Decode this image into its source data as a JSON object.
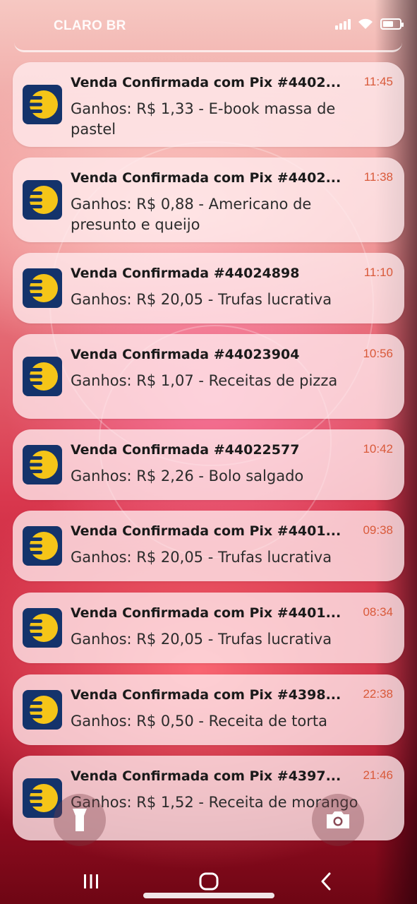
{
  "status_bar": {
    "carrier": "CLARO BR",
    "icons": [
      "signal-icon",
      "wifi-icon",
      "battery-icon"
    ]
  },
  "notifications": [
    {
      "title": "Venda Confirmada com Pix #4402...",
      "time": "11:45",
      "body": "Ganhos: R$ 1,33 - E-book massa de pastel"
    },
    {
      "title": "Venda Confirmada com Pix #4402...",
      "time": "11:38",
      "body": "Ganhos: R$ 0,88 - Americano de presunto e queijo"
    },
    {
      "title": "Venda Confirmada #44024898",
      "time": "11:10",
      "body": "Ganhos: R$ 20,05 - Trufas lucrativa"
    },
    {
      "title": "Venda Confirmada #44023904",
      "time": "10:56",
      "body": "Ganhos: R$ 1,07 - Receitas de pizza"
    },
    {
      "title": "Venda Confirmada #44022577",
      "time": "10:42",
      "body": "Ganhos: R$ 2,26 - Bolo salgado"
    },
    {
      "title": "Venda Confirmada com Pix #4401...",
      "time": "09:38",
      "body": "Ganhos: R$ 20,05 - Trufas lucrativa"
    },
    {
      "title": "Venda Confirmada com Pix #4401...",
      "time": "08:34",
      "body": "Ganhos: R$ 20,05 - Trufas lucrativa"
    },
    {
      "title": "Venda Confirmada com Pix #4398...",
      "time": "22:38",
      "body": "Ganhos: R$ 0,50 - Receita de torta"
    },
    {
      "title": "Venda Confirmada com Pix #4397...",
      "time": "21:46",
      "body": "Ganhos: R$ 1,52 - Receita de morango"
    }
  ],
  "app_icon": {
    "name": "eduzz-logo-icon",
    "bg_color": "#14336b",
    "fg_color": "#f5c518"
  },
  "shortcuts": {
    "left": "flashlight-icon",
    "right": "camera-icon"
  },
  "nav_bar": {
    "recents": "recents-icon",
    "home": "home-icon",
    "back": "back-icon"
  },
  "colors": {
    "time": "#d95a3a",
    "card_bg": "rgba(255,236,238,0.78)"
  }
}
